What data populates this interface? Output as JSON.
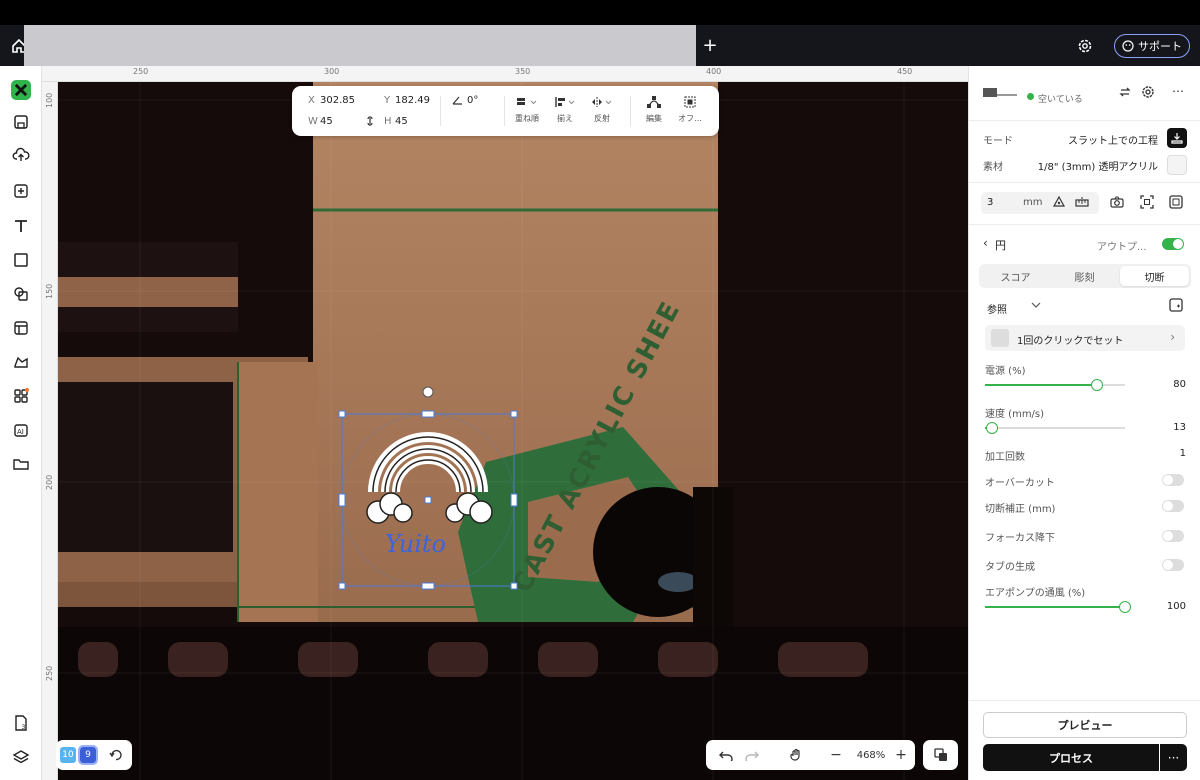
{
  "topbar": {
    "home_icon": "home-icon",
    "add_tab_label": "+",
    "settings_icon": "gear-icon",
    "support_label": "サポート"
  },
  "rulers": {
    "top": [
      "250",
      "300",
      "350",
      "400",
      "450"
    ],
    "left": [
      "100",
      "150",
      "200",
      "250"
    ]
  },
  "props": {
    "x_label": "X",
    "x_value": "302.85",
    "y_label": "Y",
    "y_value": "182.49",
    "w_label": "W",
    "w_value": "45",
    "h_label": "H",
    "h_value": "45",
    "rotation_value": "0°",
    "arrange_label": "重ね順",
    "align_label": "揃え",
    "flip_label": "反射",
    "edit_label": "編集",
    "offset_label": "オフ..."
  },
  "canvas": {
    "artwork_text": "Yuito",
    "box_text": "CAST ACRYLIC SHEE"
  },
  "bottom": {
    "layer_a": "10",
    "layer_b": "9",
    "zoom_value": "468%",
    "zoom_minus": "−",
    "zoom_plus": "+"
  },
  "panel": {
    "device_status": "空いている",
    "mode_label": "モード",
    "mode_value": "スラット上での工程",
    "material_label": "素材",
    "material_value": "1/8\" (3mm) 透明アクリル",
    "thickness_value": "3",
    "thickness_unit": "mm",
    "back_label": "円",
    "output_label": "アウトプ...",
    "tabs": [
      "スコア",
      "彫刻",
      "切断"
    ],
    "active_tab": 2,
    "preset_label": "参照",
    "preset_hint": "1回のクリックでセット",
    "power_label": "電源 (%)",
    "power_value": "80",
    "power_fraction": 0.8,
    "speed_label": "速度 (mm/s)",
    "speed_value": "13",
    "speed_fraction": 0.05,
    "passes_label": "加工回数",
    "passes_value": "1",
    "overcut_label": "オーバーカット",
    "kerf_label": "切断補正 (mm)",
    "focus_label": "フォーカス降下",
    "tabs_label": "タブの生成",
    "airpump_label": "エアポンプの通風 (%)",
    "airpump_value": "100",
    "airpump_fraction": 1.0,
    "preview_label": "プレビュー",
    "process_label": "プロセス",
    "more_label": "···"
  },
  "colors": {
    "accent_green": "#35b34a",
    "selection_blue": "#4a7bd8",
    "text_blue": "#3a64e0"
  }
}
